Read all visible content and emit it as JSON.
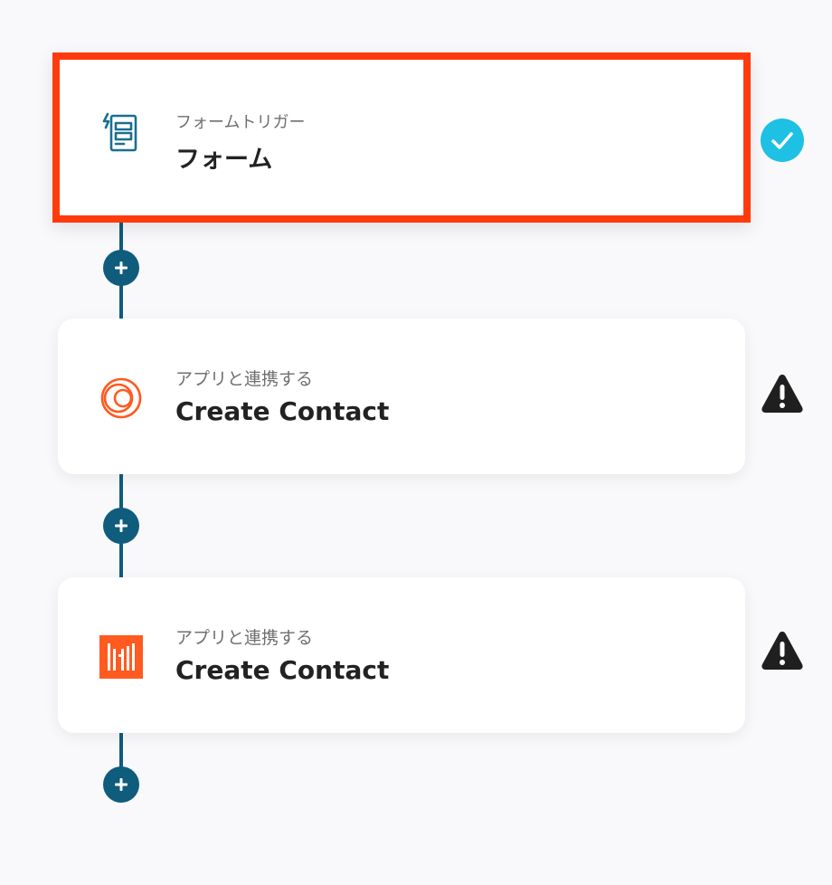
{
  "steps": [
    {
      "type_label": "フォームトリガー",
      "name": "フォーム",
      "icon": "form-trigger-icon",
      "status": "complete"
    },
    {
      "type_label": "アプリと連携する",
      "name": "Create Contact",
      "icon": "orange-rings-app-icon",
      "status": "warning"
    },
    {
      "type_label": "アプリと連携する",
      "name": "Create Contact",
      "icon": "orange-bars-app-icon",
      "status": "warning"
    }
  ],
  "colors": {
    "background": "#f9f8fb",
    "connector": "#0f5c7c",
    "highlight_border": "#ff3b0d",
    "complete": "#1ec0e4",
    "warning": "#1f1f1f",
    "app_orange": "#ff5a1f"
  }
}
